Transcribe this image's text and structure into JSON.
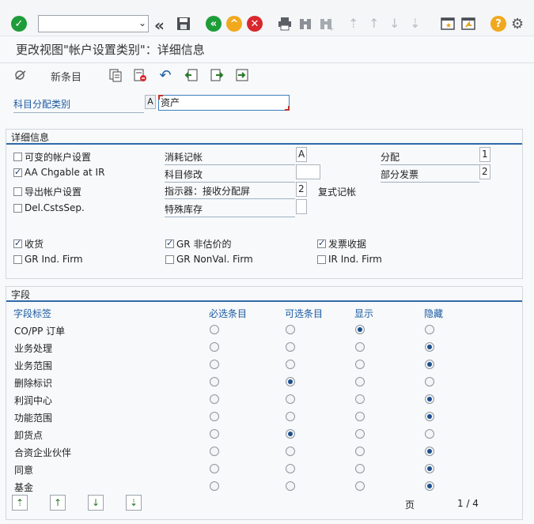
{
  "toolbar": {
    "command_placeholder": "",
    "icons": [
      "enter-icon",
      "back-icon",
      "save-icon",
      "back-nav-icon",
      "exit-icon",
      "cancel-icon",
      "print-icon",
      "find-icon",
      "find-next-icon",
      "first-page-icon",
      "prev-page-icon",
      "next-page-icon",
      "last-page-icon",
      "new-session-icon",
      "shortcut-icon",
      "help-icon",
      "settings-icon"
    ]
  },
  "title": "更改视图\"帐户设置类别\"：详细信息",
  "app_toolbar": {
    "new_entries": "新条目"
  },
  "key": {
    "label": "科目分配类别",
    "code": "A",
    "value": "资产"
  },
  "details": {
    "group_title": "详细信息",
    "checkboxes_col1": [
      {
        "label": "可变的帐户设置",
        "checked": false
      },
      {
        "label": "AA Chgable at IR",
        "checked": true
      },
      {
        "label": "导出帐户设置",
        "checked": false
      },
      {
        "label": "Del.CstsSep.",
        "checked": false
      }
    ],
    "fields_col2": [
      {
        "label": "消耗记帐",
        "value": "A"
      },
      {
        "label": "科目修改",
        "value": ""
      },
      {
        "label": "指示器：接收分配屏",
        "value": "2"
      },
      {
        "label": "特殊库存",
        "value": ""
      }
    ],
    "compound_posting": "复式记帐",
    "fields_col3": [
      {
        "label": "分配",
        "value": "1"
      },
      {
        "label": "部分发票",
        "value": "2"
      }
    ],
    "row_gr": [
      {
        "label": "收货",
        "checked": true
      },
      {
        "label": "GR 非估价的",
        "checked": true
      },
      {
        "label": "发票收据",
        "checked": true
      }
    ],
    "row_firm": [
      {
        "label": "GR Ind. Firm",
        "checked": false
      },
      {
        "label": "GR NonVal. Firm",
        "checked": false
      },
      {
        "label": "IR Ind. Firm",
        "checked": false
      }
    ]
  },
  "fields": {
    "group_title": "字段",
    "headers": [
      "字段标签",
      "必选条目",
      "可选条目",
      "显示",
      "隐藏"
    ],
    "rows": [
      {
        "label": "CO/PP 订单",
        "selected": 2
      },
      {
        "label": "业务处理",
        "selected": 3
      },
      {
        "label": "业务范围",
        "selected": 3
      },
      {
        "label": "删除标识",
        "selected": 1
      },
      {
        "label": "利润中心",
        "selected": 3
      },
      {
        "label": "功能范围",
        "selected": 3
      },
      {
        "label": "卸货点",
        "selected": 1
      },
      {
        "label": "合资企业伙伴",
        "selected": 3
      },
      {
        "label": "同意",
        "selected": 3
      },
      {
        "label": "基金",
        "selected": 3
      }
    ],
    "page_label": "页",
    "page_value": "1 / 4"
  }
}
